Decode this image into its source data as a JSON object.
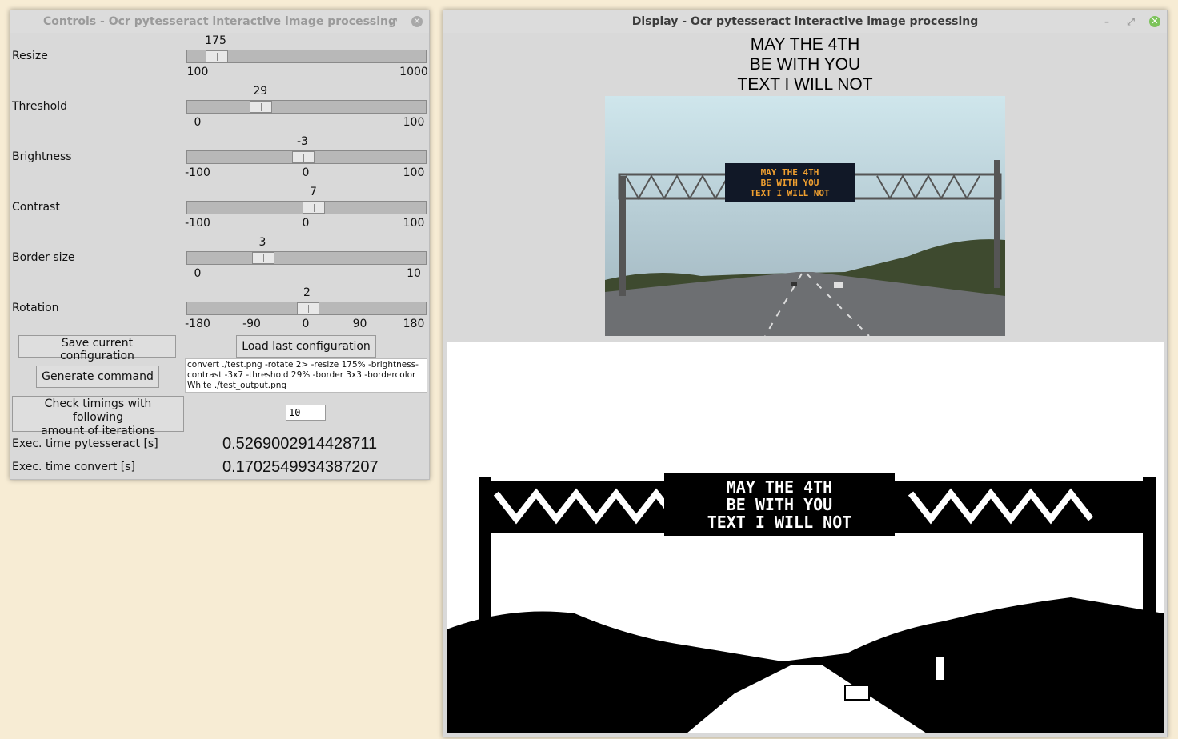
{
  "controls": {
    "title": "Controls - Ocr pytesseract interactive image processing",
    "sliders": [
      {
        "label": "Resize",
        "value": "175",
        "min": 100,
        "max": 1000,
        "ticks": [
          "100",
          "1000"
        ]
      },
      {
        "label": "Threshold",
        "value": "29",
        "min": 0,
        "max": 100,
        "ticks": [
          "0",
          "100"
        ]
      },
      {
        "label": "Brightness",
        "value": "-3",
        "min": -100,
        "max": 100,
        "ticks": [
          "-100",
          "0",
          "100"
        ]
      },
      {
        "label": "Contrast",
        "value": "7",
        "min": -100,
        "max": 100,
        "ticks": [
          "-100",
          "0",
          "100"
        ]
      },
      {
        "label": "Border size",
        "value": "3",
        "min": 0,
        "max": 10,
        "ticks": [
          "0",
          "10"
        ]
      },
      {
        "label": "Rotation",
        "value": "2",
        "min": -180,
        "max": 180,
        "ticks": [
          "-180",
          "-90",
          "0",
          "90",
          "180"
        ]
      }
    ],
    "save_label": "Save current configuration",
    "load_label": "Load last configuration",
    "generate_label": "Generate command",
    "command_text": "convert ./test.png -rotate 2> -resize 175% -brightness-contrast -3x7 -threshold 29% -border 3x3 -bordercolor White ./test_output.png",
    "timings_label_line1": "Check timings with following",
    "timings_label_line2": "amount of iterations",
    "iterations_value": "10",
    "exec_pytesseract_label": "Exec. time pytesseract [s]",
    "exec_pytesseract_value": "0.5269002914428711",
    "exec_convert_label": "Exec. time convert [s]",
    "exec_convert_value": "0.1702549934387207"
  },
  "display": {
    "title": "Display - Ocr pytesseract interactive image processing",
    "ocr_lines": [
      "MAY THE 4TH",
      "BE WITH YOU",
      "TEXT I WILL NOT"
    ],
    "sign_lines": [
      "MAY THE 4TH",
      "BE WITH YOU",
      "TEXT I WILL NOT"
    ]
  }
}
